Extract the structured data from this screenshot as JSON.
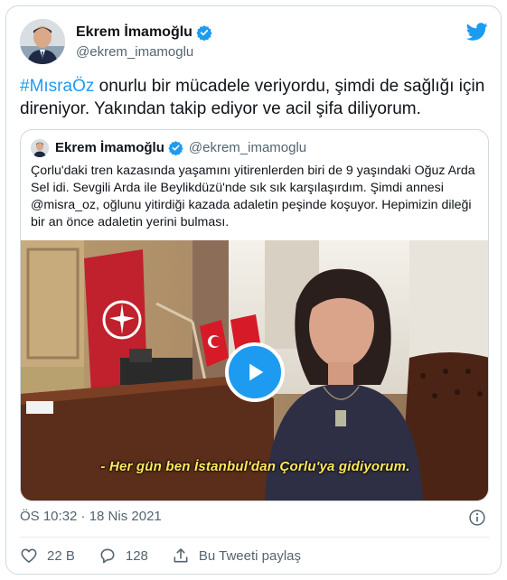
{
  "tweet": {
    "author_name": "Ekrem İmamoğlu",
    "author_handle": "@ekrem_imamoglu",
    "hashtag": "#MısraÖz",
    "text_after_hashtag": " onurlu bir mücadele veriyordu, şimdi de sağlığı için direniyor. Yakından takip ediyor ve acil şifa diliyorum.",
    "timestamp": "ÖS 10:32 · 18 Nis 2021"
  },
  "quoted_tweet": {
    "author_name": "Ekrem İmamoğlu",
    "author_handle": "@ekrem_imamoglu",
    "text": "Çorlu'daki tren kazasında yaşamını yitirenlerden biri de 9 yaşındaki Oğuz Arda Sel idi. Sevgili Arda ile Beylikdüzü'nde sık sık karşılaşırdım. Şimdi annesi @misra_oz, oğlunu yitirdiği kazada adaletin peşinde koşuyor. Hepimizin dileği bir an önce adaletin yerini bulması.",
    "video_subtitle": "- Her gün ben İstanbul'dan Çorlu'ya gidiyorum."
  },
  "actions": {
    "likes": "22 B",
    "replies": "128",
    "share_label": "Bu Tweeti paylaş"
  },
  "colors": {
    "accent": "#1d9bf0",
    "text": "#0f1419",
    "muted": "#536471",
    "border": "#cfd9de",
    "subtitle": "#ffe85c"
  },
  "icons": [
    "twitter-bird-icon",
    "verified-badge-icon",
    "play-icon",
    "info-icon",
    "heart-icon",
    "reply-icon",
    "share-icon"
  ]
}
